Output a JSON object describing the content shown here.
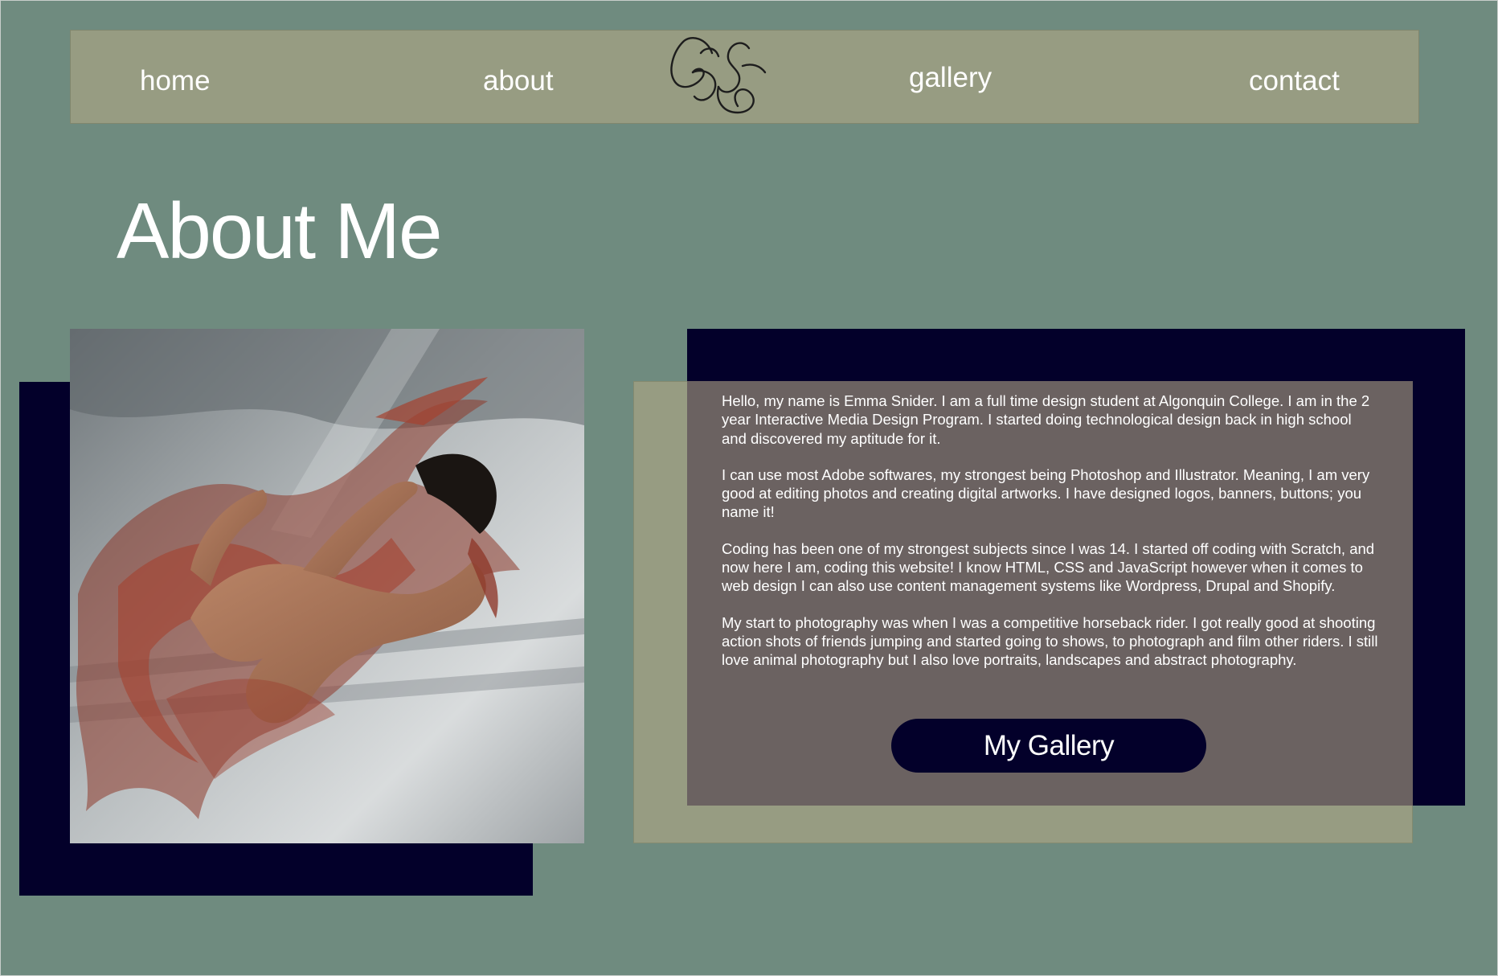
{
  "nav": {
    "home": "home",
    "about": "about",
    "gallery": "gallery",
    "contact": "contact",
    "logo_icon": "es-monogram-logo"
  },
  "page": {
    "title": "About Me"
  },
  "photo": {
    "alt": "dancer-with-red-fabric-photo"
  },
  "about": {
    "paragraphs": [
      "Hello, my name is Emma Snider. I am a full time design student at Algonquin College. I am in the 2 year Interactive Media Design Program. I started doing technological design back in high school and discovered my aptitude for it.",
      "I can use most Adobe softwares, my strongest being Photoshop and Illustrator. Meaning, I am very good at editing photos and creating digital artworks. I have designed logos, banners, buttons; you name it!",
      "Coding has been one of my strongest subjects since I was 14. I started off coding with Scratch, and now here I am, coding this website! I know HTML, CSS and JavaScript however when it comes to web design I can also use content management systems like Wordpress, Drupal and Shopify.",
      "My start to photography was when I was a competitive horseback rider. I got really good at shooting action shots of friends jumping and started going to shows, to photograph and film other riders. I still love animal photography but I also love portraits, landscapes and abstract photography."
    ],
    "button_label": "My Gallery"
  },
  "colors": {
    "background": "#6f8b7f",
    "nav_bar": "#979c82",
    "navy": "#03002a",
    "card": "#6b6261",
    "text": "#ffffff"
  }
}
